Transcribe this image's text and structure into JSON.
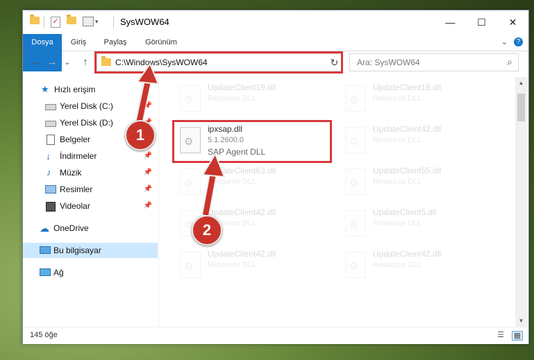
{
  "window": {
    "title": "SysWOW64",
    "controls": {
      "minimize": "—",
      "maximize": "☐",
      "close": "✕"
    }
  },
  "ribbon": {
    "tabs": [
      "Dosya",
      "Giriş",
      "Paylaş",
      "Görünüm"
    ],
    "expand_icon": "chevron-down-icon",
    "help_icon": "?"
  },
  "navigation": {
    "back": "←",
    "forward": "→",
    "recent": "⌄",
    "up": "↑",
    "address": "C:\\Windows\\SysWOW64",
    "dropdown": "⌄",
    "refresh": "↻",
    "search_placeholder": "Ara: SysWOW64",
    "search_icon": "⌕"
  },
  "sidebar": {
    "items": [
      {
        "label": "Hızlı erişim",
        "icon": "star-icon",
        "pinned": false
      },
      {
        "label": "Yerel Disk (C:)",
        "icon": "drive-icon",
        "pinned": true
      },
      {
        "label": "Yerel Disk (D:)",
        "icon": "drive-icon",
        "pinned": true
      },
      {
        "label": "Belgeler",
        "icon": "document-icon",
        "pinned": true
      },
      {
        "label": "İndirmeler",
        "icon": "download-icon",
        "pinned": true
      },
      {
        "label": "Müzik",
        "icon": "music-icon",
        "pinned": true
      },
      {
        "label": "Resimler",
        "icon": "pictures-icon",
        "pinned": true
      },
      {
        "label": "Videolar",
        "icon": "video-icon",
        "pinned": true
      },
      {
        "label": "OneDrive",
        "icon": "cloud-icon",
        "pinned": false
      },
      {
        "label": "Bu bilgisayar",
        "icon": "computer-icon",
        "pinned": false,
        "selected": true
      },
      {
        "label": "Ağ",
        "icon": "network-icon",
        "pinned": false
      }
    ]
  },
  "files": {
    "left_col": [
      {
        "name": "UpdateClient19.dll",
        "desc": "Resource DLL"
      },
      {
        "name": "ipxsap.dll",
        "desc": "5.1.2600.0",
        "extra": "SAP Agent DLL",
        "highlighted": true
      },
      {
        "name": "UpdateClient63.dll",
        "desc": "Resource DLL"
      },
      {
        "name": "UpdateClient42.dll",
        "desc": "Resource DLL"
      },
      {
        "name": "UpdateClient42.dll",
        "desc": "Resource DLL"
      }
    ],
    "right_col": [
      {
        "name": "UpdateClient19.dll",
        "desc": "Resource DLL"
      },
      {
        "name": "UpdateClient42.dll",
        "desc": "Resource DLL"
      },
      {
        "name": "UpdateClient55.dll",
        "desc": "Resource DLL"
      },
      {
        "name": "UpdateClient5.dll",
        "desc": "Resource DLL"
      },
      {
        "name": "UpdateClient42.dll",
        "desc": "Resource DLL"
      }
    ]
  },
  "status": {
    "item_count": "145 öğe"
  },
  "annotations": {
    "badge1": "1",
    "badge2": "2",
    "highlight_color": "#d8383c"
  },
  "colors": {
    "accent": "#1979ca",
    "selection": "#cce8ff"
  }
}
